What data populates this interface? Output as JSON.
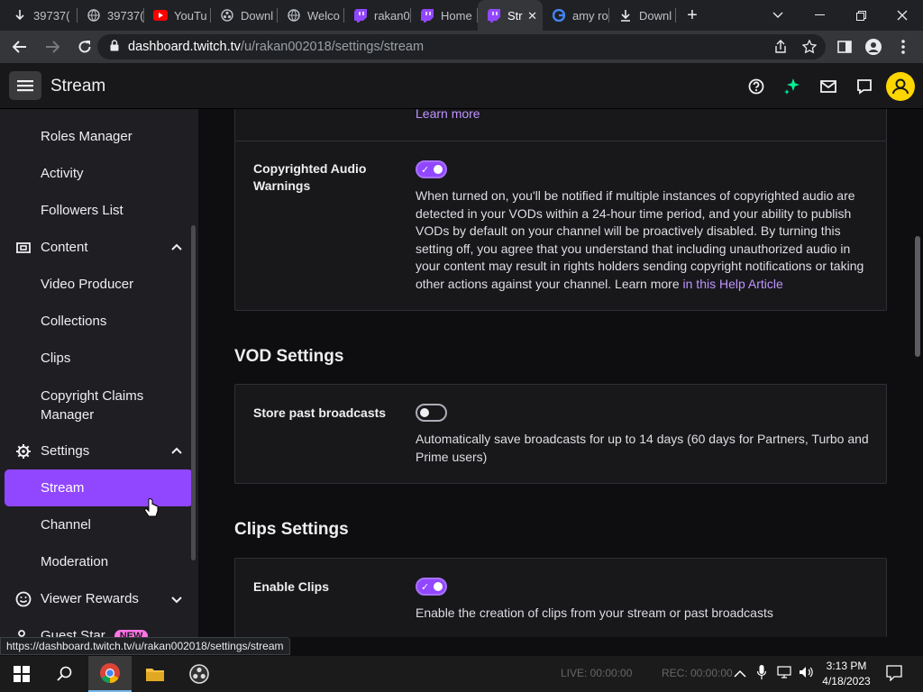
{
  "browser": {
    "tabs": [
      {
        "label": "39737(",
        "icon": "download-arrow-icon"
      },
      {
        "label": "39737(",
        "icon": "globe-icon"
      },
      {
        "label": "YouTu",
        "icon": "youtube-icon"
      },
      {
        "label": "Downl",
        "icon": "obs-icon"
      },
      {
        "label": "Welco",
        "icon": "globe-icon"
      },
      {
        "label": "rakan0",
        "icon": "twitch-icon"
      },
      {
        "label": "Home",
        "icon": "twitch-icon"
      },
      {
        "label": "Str",
        "icon": "twitch-icon",
        "active": true
      },
      {
        "label": "amy ro",
        "icon": "google-icon"
      },
      {
        "label": "Downl",
        "icon": "download-icon"
      }
    ],
    "url_host": "dashboard.twitch.tv",
    "url_path": "/u/rakan002018/settings/stream",
    "status_url": "https://dashboard.twitch.tv/u/rakan002018/settings/stream"
  },
  "header": {
    "title": "Stream"
  },
  "sidebar": {
    "items": [
      {
        "label": "Roles Manager"
      },
      {
        "label": "Activity"
      },
      {
        "label": "Followers List"
      }
    ],
    "content_section": {
      "label": "Content",
      "items": [
        "Video Producer",
        "Collections",
        "Clips",
        "Copyright Claims Manager"
      ]
    },
    "settings_section": {
      "label": "Settings",
      "items": [
        "Stream",
        "Channel",
        "Moderation"
      ]
    },
    "viewer_rewards": {
      "label": "Viewer Rewards"
    },
    "guest_star": {
      "label": "Guest Star",
      "badge": "NEW"
    }
  },
  "main": {
    "learn_more_top": "Learn more",
    "copyright": {
      "label": "Copyrighted Audio Warnings",
      "enabled": true,
      "desc": "When turned on, you'll be notified if multiple instances of copyrighted audio are detected in your VODs within a 24-hour time period, and your ability to publish VODs by default on your channel will be proactively disabled. By turning this setting off, you agree that you understand that including unauthorized audio in your content may result in rights holders sending copyright notifications or taking other actions against your channel. Learn more ",
      "link": "in this Help Article"
    },
    "vod_heading": "VOD Settings",
    "store_past": {
      "label": "Store past broadcasts",
      "enabled": false,
      "desc": "Automatically save broadcasts for up to 14 days (60 days for Partners, Turbo and Prime users)"
    },
    "clips_heading": "Clips Settings",
    "enable_clips": {
      "label": "Enable Clips",
      "enabled": true,
      "desc": "Enable the creation of clips from your stream or past broadcasts"
    }
  },
  "taskbar": {
    "time": "3:13 PM",
    "date": "4/18/2023",
    "live": "LIVE: 00:00:00",
    "rec": "REC: 00:00:00"
  },
  "colors": {
    "accent": "#9147ff",
    "link": "#bf94ff",
    "avatar": "#ffd600"
  }
}
